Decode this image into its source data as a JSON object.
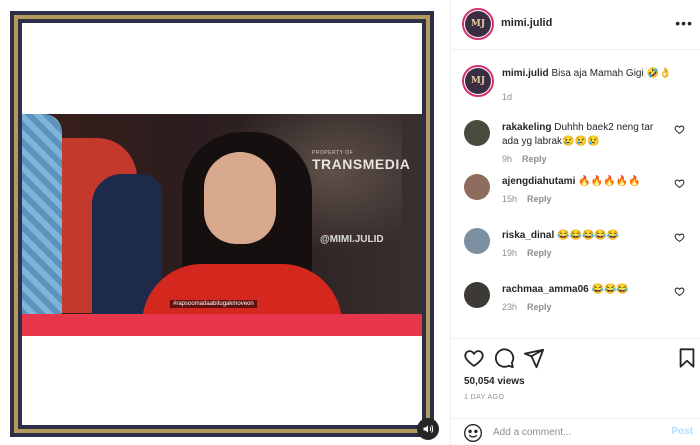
{
  "video": {
    "brand_small": "PROPERTY OF",
    "brand": "TRANSMEDIA",
    "watermark": "@MIMI.JULID",
    "caption": "#rapsoomadaabitugakmoveon"
  },
  "header": {
    "avatar_initials": "MJ",
    "username": "mimi.julid",
    "more_icon": "more-horizontal-icon"
  },
  "post": {
    "username": "mimi.julid",
    "caption": "Bisa aja Mamah Gigi 🤣👌",
    "time": "1d"
  },
  "comments": [
    {
      "username": "rakakeling",
      "text": "Duhhh baek2 neng tar ada yg labrak😢😢😢",
      "time": "9h",
      "reply": "Reply",
      "avatar_color": "#4a4a3f"
    },
    {
      "username": "ajengdiahutami",
      "text": "🔥🔥🔥🔥🔥",
      "time": "15h",
      "reply": "Reply",
      "avatar_color": "#8c6d5e"
    },
    {
      "username": "riska_dinal",
      "text": "😂😂😂😂😂",
      "time": "19h",
      "reply": "Reply",
      "avatar_color": "#7b8fa0"
    },
    {
      "username": "rachmaa_amma06",
      "text": "😂😂😂",
      "time": "23h",
      "reply": "Reply",
      "avatar_color": "#3d3a36"
    }
  ],
  "actions": {
    "views": "50,054 views",
    "ago": "1 DAY AGO"
  },
  "add_comment": {
    "placeholder": "Add a comment...",
    "post_label": "Post"
  }
}
